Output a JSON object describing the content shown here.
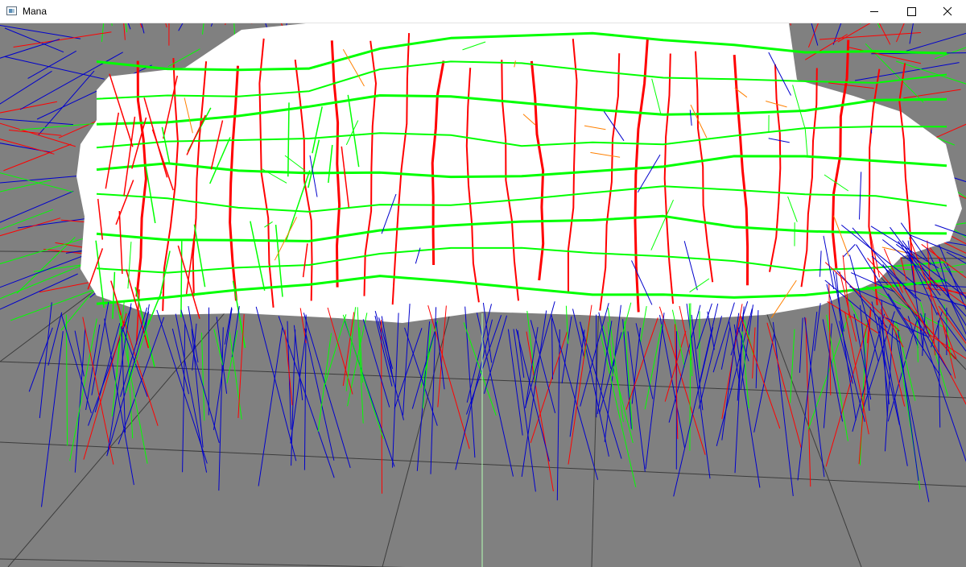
{
  "window": {
    "title": "Mana",
    "icon": "app-window-icon",
    "controls": [
      "minimize-icon",
      "maximize-icon",
      "close-icon"
    ]
  },
  "viewport": {
    "background_color": "#808080",
    "grid_color": "#3c3c3c",
    "mesh_fill_color": "#ffffff",
    "line_colors": {
      "primary_red": "#ff0000",
      "primary_green": "#00ff00",
      "normals_blue": "#0000cc",
      "accent_orange": "#ff8000",
      "axis_light_green": "#b4ffb4"
    }
  }
}
